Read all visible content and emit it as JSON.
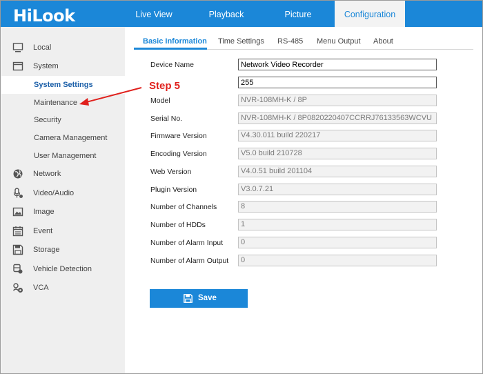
{
  "app": {
    "logo_text": "HiLook"
  },
  "colors": {
    "accent": "#1b87d8",
    "annotation": "#e0201c",
    "sidebar_bg": "#efefef"
  },
  "topnav": {
    "items": [
      {
        "label": "Live View",
        "active": false
      },
      {
        "label": "Playback",
        "active": false
      },
      {
        "label": "Picture",
        "active": false
      },
      {
        "label": "Configuration",
        "active": true
      }
    ]
  },
  "sidebar": {
    "items": [
      {
        "label": "Local",
        "icon": "monitor-icon",
        "level": 1
      },
      {
        "label": "System",
        "icon": "window-icon",
        "level": 1
      },
      {
        "label": "System Settings",
        "level": 2,
        "selected": true
      },
      {
        "label": "Maintenance",
        "level": 2
      },
      {
        "label": "Security",
        "level": 2
      },
      {
        "label": "Camera Management",
        "level": 2
      },
      {
        "label": "User Management",
        "level": 2
      },
      {
        "label": "Network",
        "icon": "globe-icon",
        "level": 1
      },
      {
        "label": "Video/Audio",
        "icon": "microphone-icon",
        "level": 1
      },
      {
        "label": "Image",
        "icon": "image-icon",
        "level": 1
      },
      {
        "label": "Event",
        "icon": "calendar-icon",
        "level": 1
      },
      {
        "label": "Storage",
        "icon": "floppy-icon",
        "level": 1
      },
      {
        "label": "Vehicle Detection",
        "icon": "vehicle-icon",
        "level": 1
      },
      {
        "label": "VCA",
        "icon": "vca-icon",
        "level": 1
      }
    ]
  },
  "tabs": [
    {
      "label": "Basic Information",
      "active": true
    },
    {
      "label": "Time Settings",
      "active": false
    },
    {
      "label": "RS-485",
      "active": false
    },
    {
      "label": "Menu Output",
      "active": false
    },
    {
      "label": "About",
      "active": false
    }
  ],
  "form": {
    "fields": [
      {
        "label": "Device Name",
        "value": "Network Video Recorder",
        "editable": true
      },
      {
        "label": "",
        "value": "255",
        "editable": true
      },
      {
        "label": "Model",
        "value": "NVR-108MH-K / 8P",
        "editable": false
      },
      {
        "label": "Serial No.",
        "value": "NVR-108MH-K / 8P0820220407CCRRJ76133563WCVU",
        "editable": false
      },
      {
        "label": "Firmware Version",
        "value": "V4.30.011 build 220217",
        "editable": false
      },
      {
        "label": "Encoding Version",
        "value": "V5.0 build 210728",
        "editable": false
      },
      {
        "label": "Web Version",
        "value": "V4.0.51 build 201104",
        "editable": false
      },
      {
        "label": "Plugin Version",
        "value": "V3.0.7.21",
        "editable": false
      },
      {
        "label": "Number of Channels",
        "value": "8",
        "editable": false
      },
      {
        "label": "Number of HDDs",
        "value": "1",
        "editable": false
      },
      {
        "label": "Number of Alarm Input",
        "value": "0",
        "editable": false
      },
      {
        "label": "Number of Alarm Output",
        "value": "0",
        "editable": false
      }
    ],
    "save_label": "Save"
  },
  "annotation": {
    "text": "Step 5"
  }
}
